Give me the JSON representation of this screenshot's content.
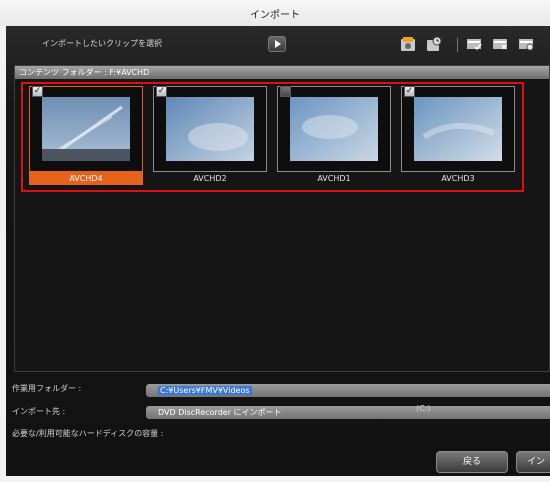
{
  "window": {
    "title": "インポート"
  },
  "toolbar": {
    "instruction": "インポートしたいクリップを選択",
    "tools": [
      "import-disc-icon",
      "import-schedule-icon",
      "check-all-icon",
      "uncheck-all-icon",
      "settings-icon"
    ]
  },
  "panel": {
    "header": "コンテンツ フォルダー : F:¥AVCHD",
    "clips": [
      {
        "label": "AVCHD4",
        "checked": true,
        "selected": true
      },
      {
        "label": "AVCHD2",
        "checked": true,
        "selected": false
      },
      {
        "label": "AVCHD1",
        "checked": false,
        "selected": false
      },
      {
        "label": "AVCHD3",
        "checked": true,
        "selected": false
      }
    ]
  },
  "bottom": {
    "work_folder_label": "作業用フォルダー :",
    "work_folder_value": "C:¥Users¥FMV¥Videos",
    "import_to_label": "インポート先 :",
    "import_to_value": "DVD DiscRecorder にインポート",
    "disk_label": "必要な/利用可能なハードディスクの容量 :",
    "drive": "(C:)"
  },
  "buttons": {
    "back": "戻る",
    "import": "イン"
  },
  "colors": {
    "selection_orange": "#e4621b",
    "highlight_red": "#e01010",
    "field_selection_blue": "#3a78d8"
  }
}
